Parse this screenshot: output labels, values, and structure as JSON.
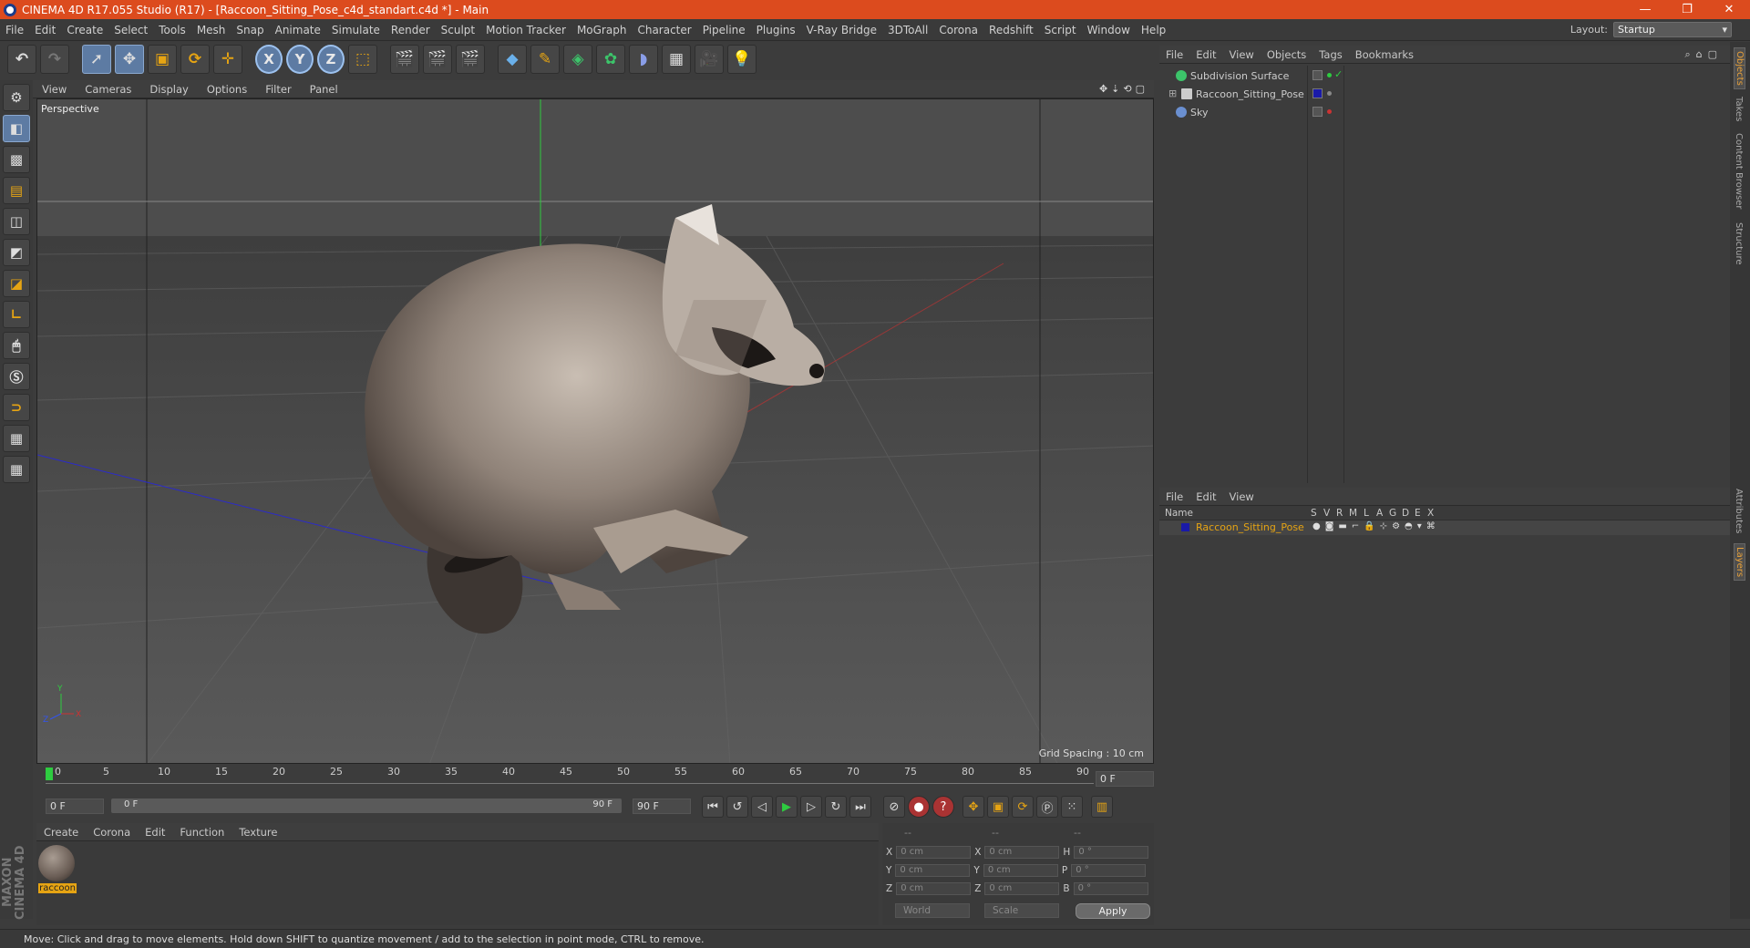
{
  "titlebar": {
    "title": "CINEMA 4D R17.055 Studio (R17) - [Raccoon_Sitting_Pose_c4d_standart.c4d *] - Main",
    "min": "—",
    "max": "❐",
    "close": "✕"
  },
  "menu": [
    "File",
    "Edit",
    "Create",
    "Select",
    "Tools",
    "Mesh",
    "Snap",
    "Animate",
    "Simulate",
    "Render",
    "Sculpt",
    "Motion Tracker",
    "MoGraph",
    "Character",
    "Pipeline",
    "Plugins",
    "V-Ray Bridge",
    "3DToAll",
    "Corona",
    "Redshift",
    "Script",
    "Window",
    "Help"
  ],
  "layout": {
    "label": "Layout:",
    "value": "Startup"
  },
  "viewport": {
    "menu": [
      "View",
      "Cameras",
      "Display",
      "Options",
      "Filter",
      "Panel"
    ],
    "nav_icons": "✥⇣⟲▢",
    "label": "Perspective",
    "grid_spacing": "Grid Spacing : 10 cm",
    "axes": {
      "x": "X",
      "y": "Y",
      "z": "Z"
    }
  },
  "timeline": {
    "ticks": [
      "0",
      "5",
      "10",
      "15",
      "20",
      "25",
      "30",
      "35",
      "40",
      "45",
      "50",
      "55",
      "60",
      "65",
      "70",
      "75",
      "80",
      "85",
      "90"
    ],
    "current_frame": "0 F",
    "start_frame": "0 F",
    "range_start": "0 F",
    "range_end": "90 F",
    "end_frame": "90 F"
  },
  "material_manager": {
    "menu": [
      "Create",
      "Corona",
      "Edit",
      "Function",
      "Texture"
    ],
    "materials": [
      {
        "name": "raccoon"
      }
    ]
  },
  "coords": {
    "header": [
      "--",
      "--",
      "--"
    ],
    "rows": [
      {
        "a": "X",
        "av": "0 cm",
        "b": "X",
        "bv": "0 cm",
        "c": "H",
        "cv": "0 °"
      },
      {
        "a": "Y",
        "av": "0 cm",
        "b": "Y",
        "bv": "0 cm",
        "c": "P",
        "cv": "0 °"
      },
      {
        "a": "Z",
        "av": "0 cm",
        "b": "Z",
        "bv": "0 cm",
        "c": "B",
        "cv": "0 °"
      }
    ],
    "mode": "World",
    "size": "Scale",
    "apply": "Apply"
  },
  "object_manager": {
    "menu": [
      "File",
      "Edit",
      "View",
      "Objects",
      "Tags",
      "Bookmarks"
    ],
    "objects": [
      {
        "name": "Subdivision Surface",
        "color": "#3cc46a"
      },
      {
        "name": "Raccoon_Sitting_Pose",
        "color": "#cccccc"
      },
      {
        "name": "Sky",
        "color": "#6a8fd0"
      }
    ]
  },
  "layer_manager": {
    "menu": [
      "File",
      "Edit",
      "View"
    ],
    "header": {
      "name": "Name",
      "cols": [
        "S",
        "V",
        "R",
        "M",
        "L",
        "A",
        "G",
        "D",
        "E",
        "X"
      ]
    },
    "layers": [
      {
        "name": "Raccoon_Sitting_Pose",
        "color": "#1a1aa8"
      }
    ]
  },
  "side_tabs": [
    "Objects",
    "Takes",
    "Content Browser",
    "Structure",
    "Attributes",
    "Layers"
  ],
  "brand": "MAXON CINEMA 4D",
  "status": "Move: Click and drag to move elements. Hold down SHIFT to quantize movement / add to the selection in point mode, CTRL to remove.",
  "colors": {
    "titlebar": "#dc4b1e",
    "accent_orange": "#e6a413",
    "selection_blue": "#5d7ba3"
  }
}
